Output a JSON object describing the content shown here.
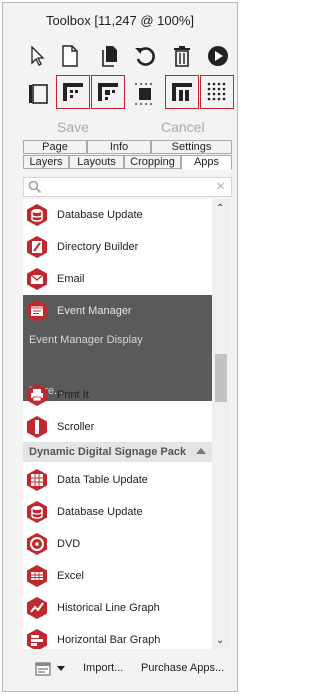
{
  "toolbox": {
    "title": "Toolbox [11,247 @ 100%]",
    "save_label": "Save",
    "cancel_label": "Cancel"
  },
  "tabs": {
    "row1": [
      "Page",
      "Info",
      "Settings"
    ],
    "row2": [
      "Layers",
      "Layouts",
      "Cropping",
      "Apps"
    ],
    "active": "Apps"
  },
  "search": {
    "placeholder": "",
    "value": ""
  },
  "apps": {
    "items": [
      {
        "label": "Database Update",
        "icon": "database-icon"
      },
      {
        "label": "Directory Builder",
        "icon": "directory-icon"
      },
      {
        "label": "Email",
        "icon": "email-icon"
      },
      {
        "label": "Event Manager",
        "icon": "event-icon"
      }
    ],
    "hover_sub": "Event Manager Display",
    "more_label": "More...",
    "items_after": [
      {
        "label": "Print It",
        "icon": "print-icon"
      },
      {
        "label": "Scroller",
        "icon": "scroller-icon"
      }
    ],
    "group_label": "Dynamic Digital Signage Pack",
    "group_items": [
      {
        "label": "Data Table Update",
        "icon": "data-table-icon"
      },
      {
        "label": "Database Update",
        "icon": "database-icon"
      },
      {
        "label": "DVD",
        "icon": "dvd-icon"
      },
      {
        "label": "Excel",
        "icon": "excel-icon"
      },
      {
        "label": "Historical Line Graph",
        "icon": "line-graph-icon"
      },
      {
        "label": "Horizontal Bar Graph",
        "icon": "bar-graph-icon"
      }
    ]
  },
  "footer": {
    "import_label": "Import...",
    "purchase_label": "Purchase Apps..."
  },
  "colors": {
    "accent": "#c0282d",
    "hover_bg": "#5a5a5a",
    "group_bg": "#e4e4e4"
  }
}
